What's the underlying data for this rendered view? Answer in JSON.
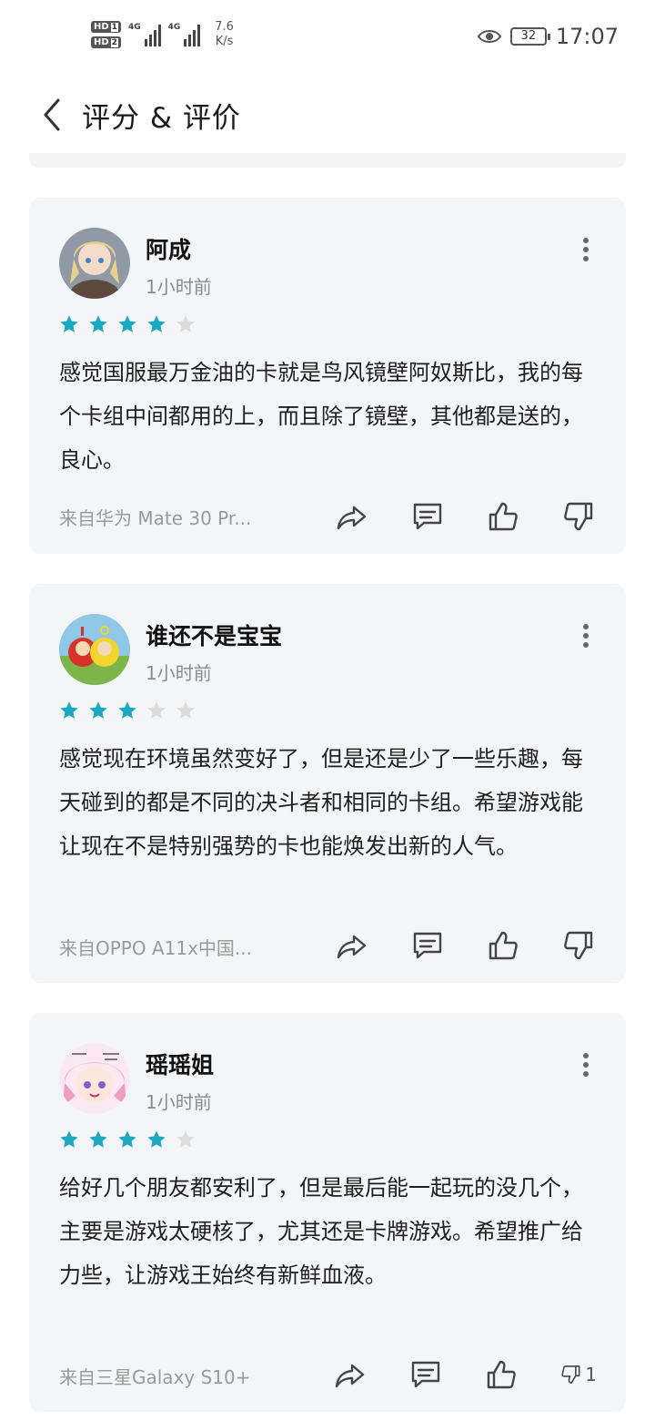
{
  "status_bar": {
    "sim1": "HD",
    "sim1_slot": "1",
    "sim2": "HD",
    "sim2_slot": "2",
    "net1": "4G",
    "net2": "4G",
    "speed_value": "7.6",
    "speed_unit": "K/s",
    "battery": "32",
    "time": "17:07"
  },
  "header": {
    "title": "评分 & 评价"
  },
  "colors": {
    "star_filled": "#1aa9c1",
    "star_empty": "#dcdcdc",
    "card_bg": "#f4f5f7"
  },
  "reviews": [
    {
      "name": "阿成",
      "time": "1小时前",
      "rating": 4,
      "text": "感觉国服最万金油的卡就是鸟风镜壁阿奴斯比，我的每个卡组中间都用的上，而且除了镜壁，其他都是送的，良心。",
      "device": "来自华为 Mate 30 Pr...",
      "dislike_count": ""
    },
    {
      "name": "谁还不是宝宝",
      "time": "1小时前",
      "rating": 3,
      "text": "感觉现在环境虽然变好了，但是还是少了一些乐趣，每天碰到的都是不同的决斗者和相同的卡组。希望游戏能让现在不是特别强势的卡也能焕发出新的人气。",
      "device": "来自OPPO A11x中国...",
      "dislike_count": ""
    },
    {
      "name": "瑶瑶姐",
      "time": "1小时前",
      "rating": 4,
      "text": "给好几个朋友都安利了，但是最后能一起玩的没几个，主要是游戏太硬核了，尤其还是卡牌游戏。希望推广给力些，让游戏王始终有新鲜血液。",
      "device": "来自三星Galaxy S10+",
      "dislike_count": "1"
    }
  ]
}
